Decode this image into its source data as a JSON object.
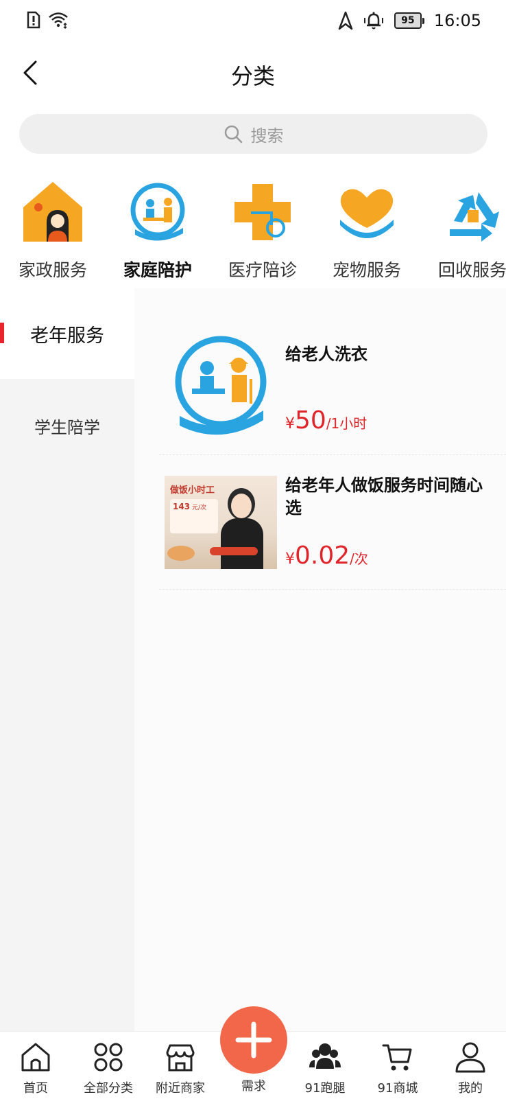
{
  "status_bar": {
    "battery": "95",
    "time": "16:05"
  },
  "header": {
    "title": "分类"
  },
  "search": {
    "placeholder": "搜索"
  },
  "categories": [
    {
      "label": "家政服务",
      "icon": "house-cleaner-icon"
    },
    {
      "label": "家庭陪护",
      "icon": "family-care-icon",
      "active": true
    },
    {
      "label": "医疗陪诊",
      "icon": "medical-cross-icon"
    },
    {
      "label": "宠物服务",
      "icon": "pet-hands-icon"
    },
    {
      "label": "回收服务",
      "icon": "recycle-icon"
    }
  ],
  "sidebar": {
    "items": [
      {
        "label": "老年服务",
        "active": true
      },
      {
        "label": "学生陪学"
      }
    ]
  },
  "products": [
    {
      "title": "给老人洗衣",
      "currency": "¥",
      "price": "50",
      "unit": "/1小时"
    },
    {
      "title": "给老年人做饭服务时间随心选",
      "currency": "¥",
      "price": "0.02",
      "unit": "/次",
      "thumb": {
        "banner_text": "做饭小时工",
        "price_tag": "143",
        "unit_tag": "元/次"
      }
    }
  ],
  "tabbar": {
    "items": [
      {
        "label": "首页",
        "icon": "home-icon"
      },
      {
        "label": "全部分类",
        "icon": "grid-circles-icon"
      },
      {
        "label": "附近商家",
        "icon": "store-icon"
      },
      {
        "label": "需求",
        "icon": "plus-icon"
      },
      {
        "label": "91跑腿",
        "icon": "runners-icon"
      },
      {
        "label": "91商城",
        "icon": "cart-icon"
      },
      {
        "label": "我的",
        "icon": "user-icon"
      }
    ]
  },
  "colors": {
    "accent_red": "#e0262b",
    "fab_orange": "#f2664a",
    "blue": "#2aa4e0",
    "orange": "#f5a623"
  }
}
